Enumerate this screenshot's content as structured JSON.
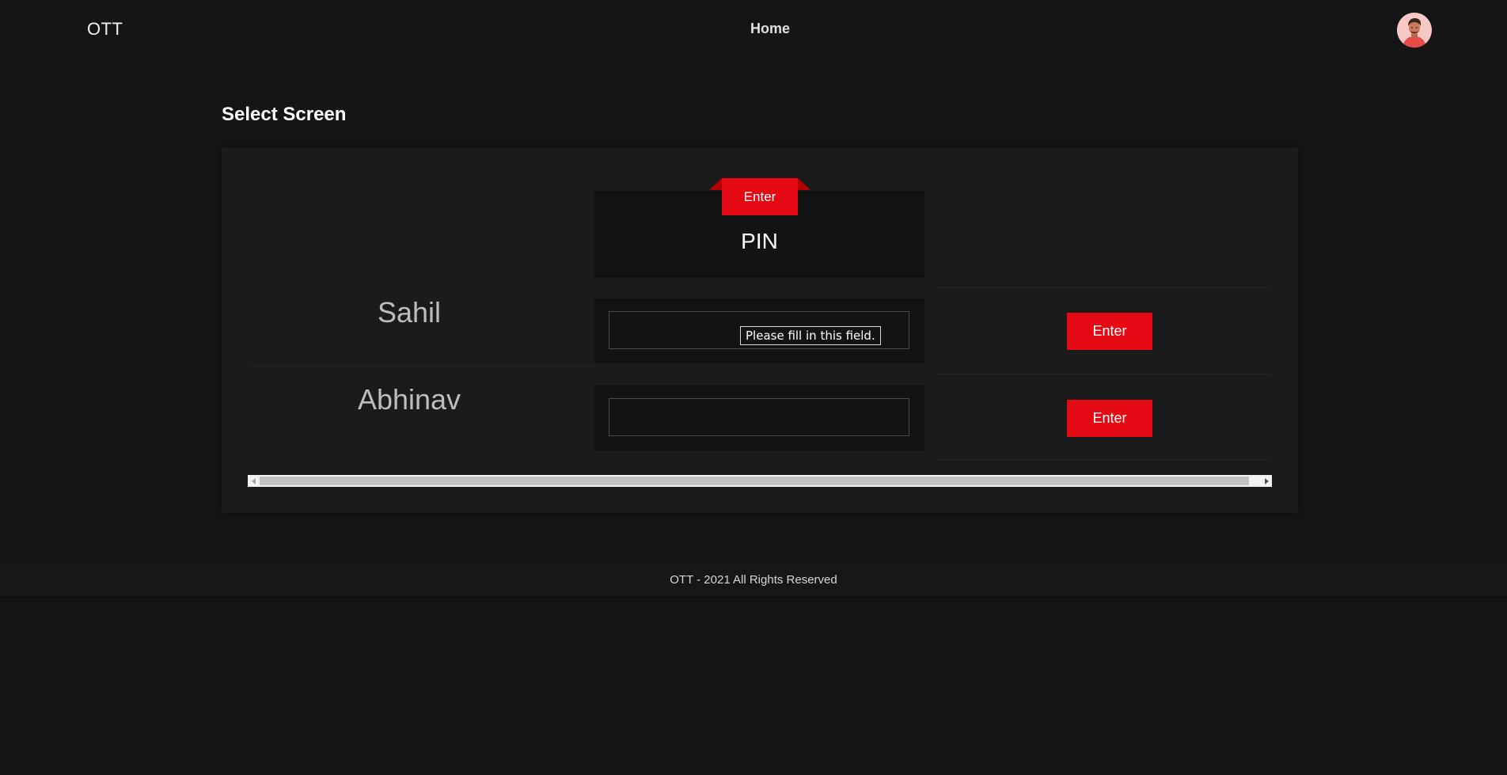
{
  "header": {
    "brand": "OTT",
    "nav_home": "Home",
    "avatar_icon": "user-avatar-icon"
  },
  "page": {
    "title": "Select Screen"
  },
  "table": {
    "ribbon_label": "Enter",
    "pin_column_header": "PIN",
    "rows": [
      {
        "name": "Sahil",
        "pin_value": "",
        "button_label": "Enter"
      },
      {
        "name": "Abhinav",
        "pin_value": "",
        "button_label": "Enter"
      }
    ],
    "validation_tooltip": "Please fill in this field."
  },
  "footer": {
    "text": "OTT - 2021 All Rights Reserved"
  },
  "colors": {
    "background": "#151515",
    "panel": "#1b1b1b",
    "accent_red": "#e50914"
  }
}
